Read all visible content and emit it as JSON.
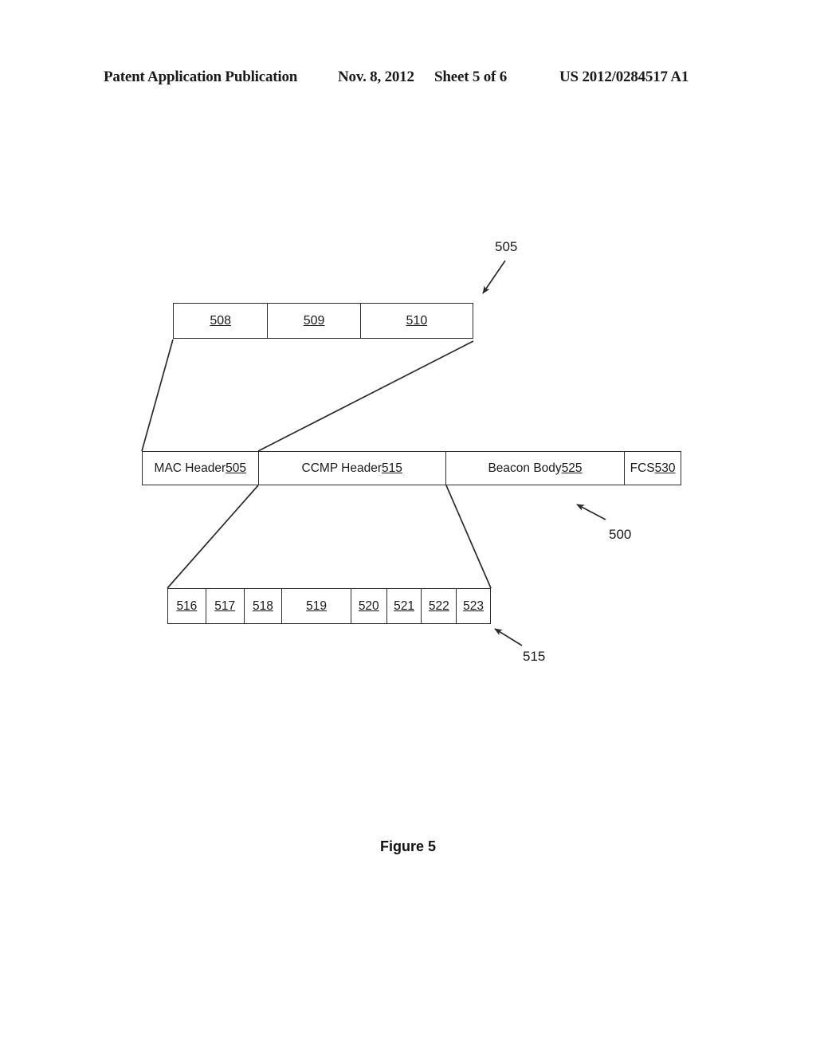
{
  "header": {
    "publication": "Patent Application Publication",
    "date": "Nov. 8, 2012",
    "sheet": "Sheet 5 of 6",
    "patent_number": "US 2012/0284517 A1"
  },
  "figure": {
    "caption": "Figure 5",
    "line_color": "#2b2b2b"
  },
  "top_detail_box": {
    "name": "mac-header-detail",
    "cells": [
      {
        "label": "",
        "ref": "508"
      },
      {
        "label": "",
        "ref": "509"
      },
      {
        "label": "",
        "ref": "510"
      }
    ]
  },
  "main_frame_box": {
    "name": "beacon-frame",
    "cells": [
      {
        "label": "MAC Header ",
        "ref": "505"
      },
      {
        "label": "CCMP Header ",
        "ref": "515"
      },
      {
        "label": "Beacon Body ",
        "ref": "525"
      },
      {
        "label": "FCS ",
        "ref": "530"
      }
    ]
  },
  "ccmp_detail_box": {
    "name": "ccmp-header-detail",
    "cells": [
      {
        "label": "",
        "ref": "516"
      },
      {
        "label": "",
        "ref": "517"
      },
      {
        "label": "",
        "ref": "518"
      },
      {
        "label": "",
        "ref": "519"
      },
      {
        "label": "",
        "ref": "520"
      },
      {
        "label": "",
        "ref": "521"
      },
      {
        "label": "",
        "ref": "522"
      },
      {
        "label": "",
        "ref": "523"
      }
    ]
  },
  "callouts": [
    {
      "id": "505",
      "text": "505"
    },
    {
      "id": "500",
      "text": "500"
    },
    {
      "id": "515",
      "text": "515"
    }
  ]
}
